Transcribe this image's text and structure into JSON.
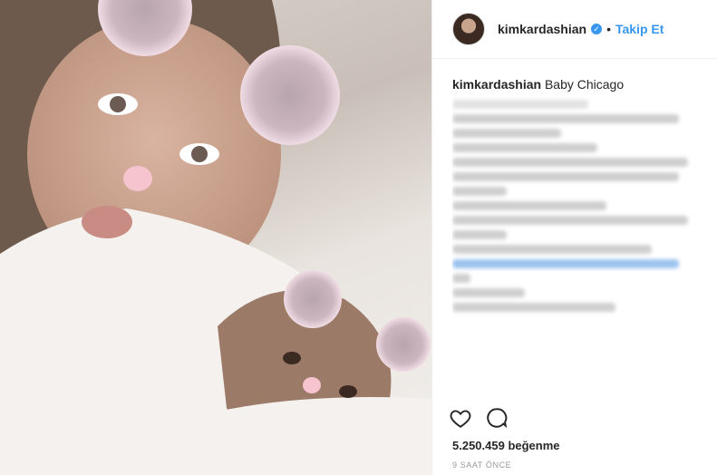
{
  "post": {
    "username": "kimkardashian",
    "follow_label": "Takip Et",
    "caption_user": "kimkardashian",
    "caption_text": "Baby Chicago",
    "likes": "5.250.459 beğenme",
    "timestamp": "9 SAAT ÖNCE"
  },
  "colors": {
    "link": "#3897f0",
    "text": "#262626",
    "muted": "#999999"
  },
  "icons": {
    "verified": "verified-badge-icon",
    "like": "heart-icon",
    "comment": "comment-icon"
  }
}
